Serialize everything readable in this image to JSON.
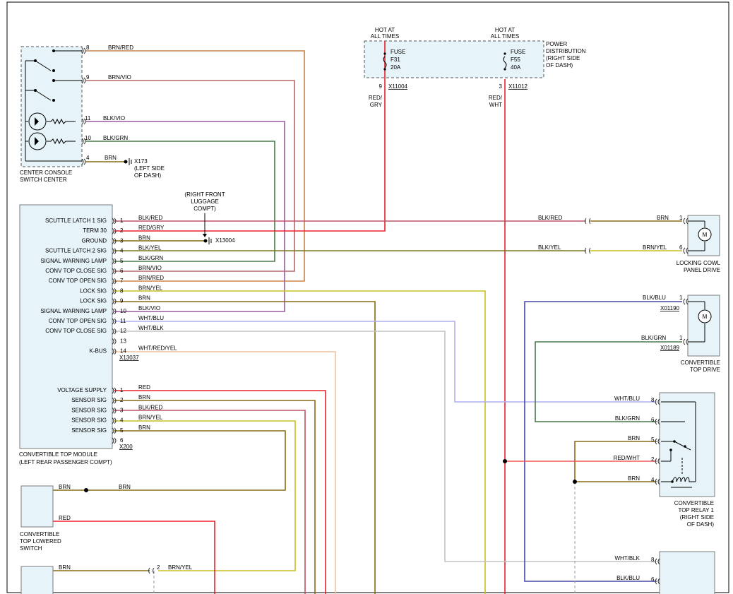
{
  "colors": {
    "background": "#ffffff",
    "component_fill": "#e6f3f9",
    "component_border": "#7a7a7a",
    "wire": {
      "RED": "#e8202a",
      "BRN": "#8a6a14",
      "BLK/RED": "#c0506a",
      "BLK/GRY": "#9a9a9a",
      "RED/GRY": "#e8202a",
      "RED/WHT": "#ef5a5a",
      "BRN/RED": "#c8844a",
      "BRN/VIO": "#b86868",
      "BRN/YEL": "#c8c020",
      "BLK/VIO": "#9a5aa0",
      "BLK/GRN": "#4a7a4a",
      "BLK/YEL": "#7a7a1e",
      "BLK/BLU": "#4646aa",
      "WHT/BLU": "#aeaef0",
      "WHT/BLK": "#c4c4c4",
      "WHT/RED/YEL": "#f0c4a0"
    }
  },
  "center_console": {
    "name": "CENTER CONSOLE",
    "name2": "SWITCH CENTER",
    "pins": [
      {
        "pin": "8",
        "color": "BRN/RED"
      },
      {
        "pin": "9",
        "color": "BRN/VIO"
      },
      {
        "pin": "11",
        "color": "BLK/VIO"
      },
      {
        "pin": "10",
        "color": "BLK/GRN"
      },
      {
        "pin": "4",
        "color": "BRN"
      }
    ],
    "ground_id": "X173",
    "ground_loc1": "(LEFT SIDE",
    "ground_loc2": "OF DASH)"
  },
  "power_dist": {
    "title1": "POWER",
    "title2": "DISTRIBUTION",
    "title3": "(RIGHT SIDE",
    "title4": "OF DASH)",
    "hot1": "HOT AT",
    "hot2": "ALL TIMES",
    "fuses": [
      {
        "label": "FUSE",
        "id": "F31",
        "rating": "20A",
        "pin": "9",
        "connector": "X11004",
        "wire1": "RED/",
        "wire2": "GRY"
      },
      {
        "label": "FUSE",
        "id": "F55",
        "rating": "40A",
        "pin": "3",
        "connector": "X11012",
        "wire1": "RED/",
        "wire2": "WHT"
      }
    ]
  },
  "module": {
    "name1": "CONVERTIBLE TOP MODULE",
    "name2": "(LEFT REAR PASSENGER COMPT)",
    "conn1": "X13037",
    "conn2": "X200",
    "pins1": [
      {
        "label": "SCUTTLE LATCH 1 SIG",
        "pin": "1",
        "color": "BLK/RED"
      },
      {
        "label": "TERM 30",
        "pin": "2",
        "color": "RED/GRY"
      },
      {
        "label": "GROUND",
        "pin": "3",
        "color": "BRN"
      },
      {
        "label": "SCUTTLE LATCH 2 SIG",
        "pin": "4",
        "color": "BLK/YEL"
      },
      {
        "label": "SIGNAL WARNING LAMP",
        "pin": "5",
        "color": "BLK/GRN"
      },
      {
        "label": "CONV TOP CLOSE SIG",
        "pin": "6",
        "color": "BRN/VIO"
      },
      {
        "label": "CONV TOP OPEN SIG",
        "pin": "7",
        "color": "BRN/RED"
      },
      {
        "label": "LOCK SIG",
        "pin": "8",
        "color": "BRN/YEL"
      },
      {
        "label": "LOCK SIG",
        "pin": "9",
        "color": "BRN"
      },
      {
        "label": "SIGNAL WARNING LAMP",
        "pin": "10",
        "color": "BLK/VIO"
      },
      {
        "label": "CONV TOP OPEN SIG",
        "pin": "11",
        "color": "WHT/BLU"
      },
      {
        "label": "CONV TOP CLOSE SIG",
        "pin": "12",
        "color": "WHT/BLK"
      },
      {
        "label": "",
        "pin": "13",
        "color": ""
      },
      {
        "label": "K-BUS",
        "pin": "14",
        "color": "WHT/RED/YEL"
      }
    ],
    "pins2": [
      {
        "label": "VOLTAGE SUPPLY",
        "pin": "1",
        "color": "RED"
      },
      {
        "label": "SENSOR SIG",
        "pin": "2",
        "color": "BRN"
      },
      {
        "label": "SENSOR SIG",
        "pin": "3",
        "color": "BLK/RED"
      },
      {
        "label": "SENSOR SIG",
        "pin": "4",
        "color": "BRN/YEL"
      },
      {
        "label": "SENSOR SIG",
        "pin": "5",
        "color": "BRN"
      },
      {
        "label": "",
        "pin": "6",
        "color": ""
      }
    ]
  },
  "ground_x13004": {
    "label1": "(RIGHT FRONT",
    "label2": "LUGGAGE",
    "label3": "COMPT)",
    "id": "X13004"
  },
  "locking_cowl": {
    "name1": "LOCKING COWL",
    "name2": "PANEL DRIVE",
    "motor": "M",
    "pins": [
      {
        "pin": "1",
        "color": "BRN",
        "splice_color": "BLK/RED"
      },
      {
        "pin": "6",
        "color": "BRN/YEL",
        "splice_color": "BLK/YEL"
      }
    ]
  },
  "top_drive": {
    "name1": "CONVERTIBLE",
    "name2": "TOP DRIVE",
    "motor": "M",
    "pins": [
      {
        "pin": "1",
        "color": "BLK/BLU",
        "connector": "X01190"
      },
      {
        "pin": "1",
        "color": "BLK/GRN",
        "connector": "X01189"
      }
    ]
  },
  "relay1": {
    "name1": "CONVERTIBLE",
    "name2": "TOP RELAY 1",
    "name3": "(RIGHT SIDE",
    "name4": "OF DASH)",
    "pins": [
      {
        "pin": "8",
        "color": "WHT/BLU"
      },
      {
        "pin": "6",
        "color": "BLK/GRN"
      },
      {
        "pin": "5",
        "color": "BRN"
      },
      {
        "pin": "2",
        "color": "RED/WHT"
      },
      {
        "pin": "4",
        "color": "BRN"
      }
    ]
  },
  "relay2": {
    "pins": [
      {
        "pin": "8",
        "color": "WHT/BLK"
      },
      {
        "pin": "6",
        "color": "BLK/BLU"
      }
    ]
  },
  "lowered_switch": {
    "name1": "CONVERTIBLE",
    "name2": "TOP LOWERED",
    "name3": "SWITCH",
    "wires": [
      "BRN",
      "BRN",
      "RED"
    ]
  },
  "bottom_switch": {
    "wire_left": "BRN",
    "pin": "2",
    "wire_right": "BRN/YEL"
  }
}
